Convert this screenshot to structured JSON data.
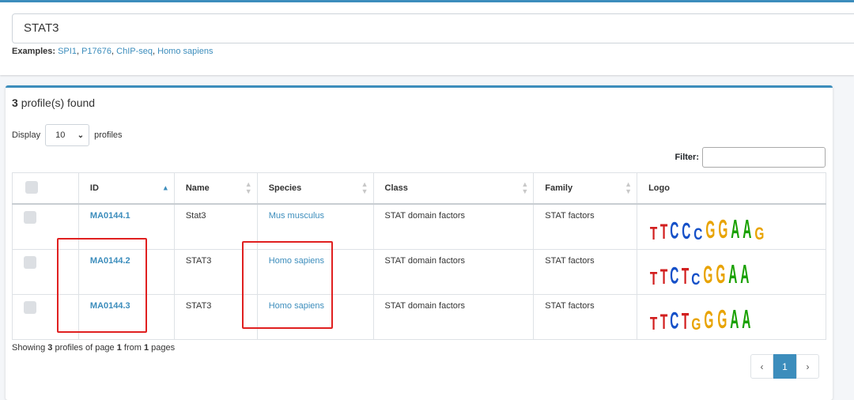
{
  "search": {
    "value": "STAT3"
  },
  "examples": {
    "label": "Examples:",
    "links": [
      "SPI1",
      "P17676",
      "ChIP-seq",
      "Homo sapiens"
    ]
  },
  "results": {
    "count": "3",
    "found_label": "profile(s) found",
    "display_label": "Display",
    "display_value": "10",
    "profiles_label": "profiles",
    "filter_label": "Filter:"
  },
  "table": {
    "headers": [
      "ID",
      "Name",
      "Species",
      "Class",
      "Family",
      "Logo"
    ],
    "rows": [
      {
        "id": "MA0144.1",
        "name": "Stat3",
        "species": "Mus musculus",
        "class": "STAT domain factors",
        "family": "STAT factors",
        "logo": "TTCCCGGAAG"
      },
      {
        "id": "MA0144.2",
        "name": "STAT3",
        "species": "Homo sapiens",
        "class": "STAT domain factors",
        "family": "STAT factors",
        "logo": "TTCTCGGAA"
      },
      {
        "id": "MA0144.3",
        "name": "STAT3",
        "species": "Homo sapiens",
        "class": "STAT domain factors",
        "family": "STAT factors",
        "logo": "TTCTGGGAA"
      }
    ]
  },
  "footer": {
    "showing": "Showing",
    "count": "3",
    "mid": "profiles of page",
    "page": "1",
    "from": "from",
    "pages": "1",
    "pages_label": "pages"
  },
  "pagination": {
    "prev": "‹",
    "current": "1",
    "next": "›"
  },
  "colors": {
    "accent": "#3c8dbc",
    "highlight": "#e02020"
  }
}
